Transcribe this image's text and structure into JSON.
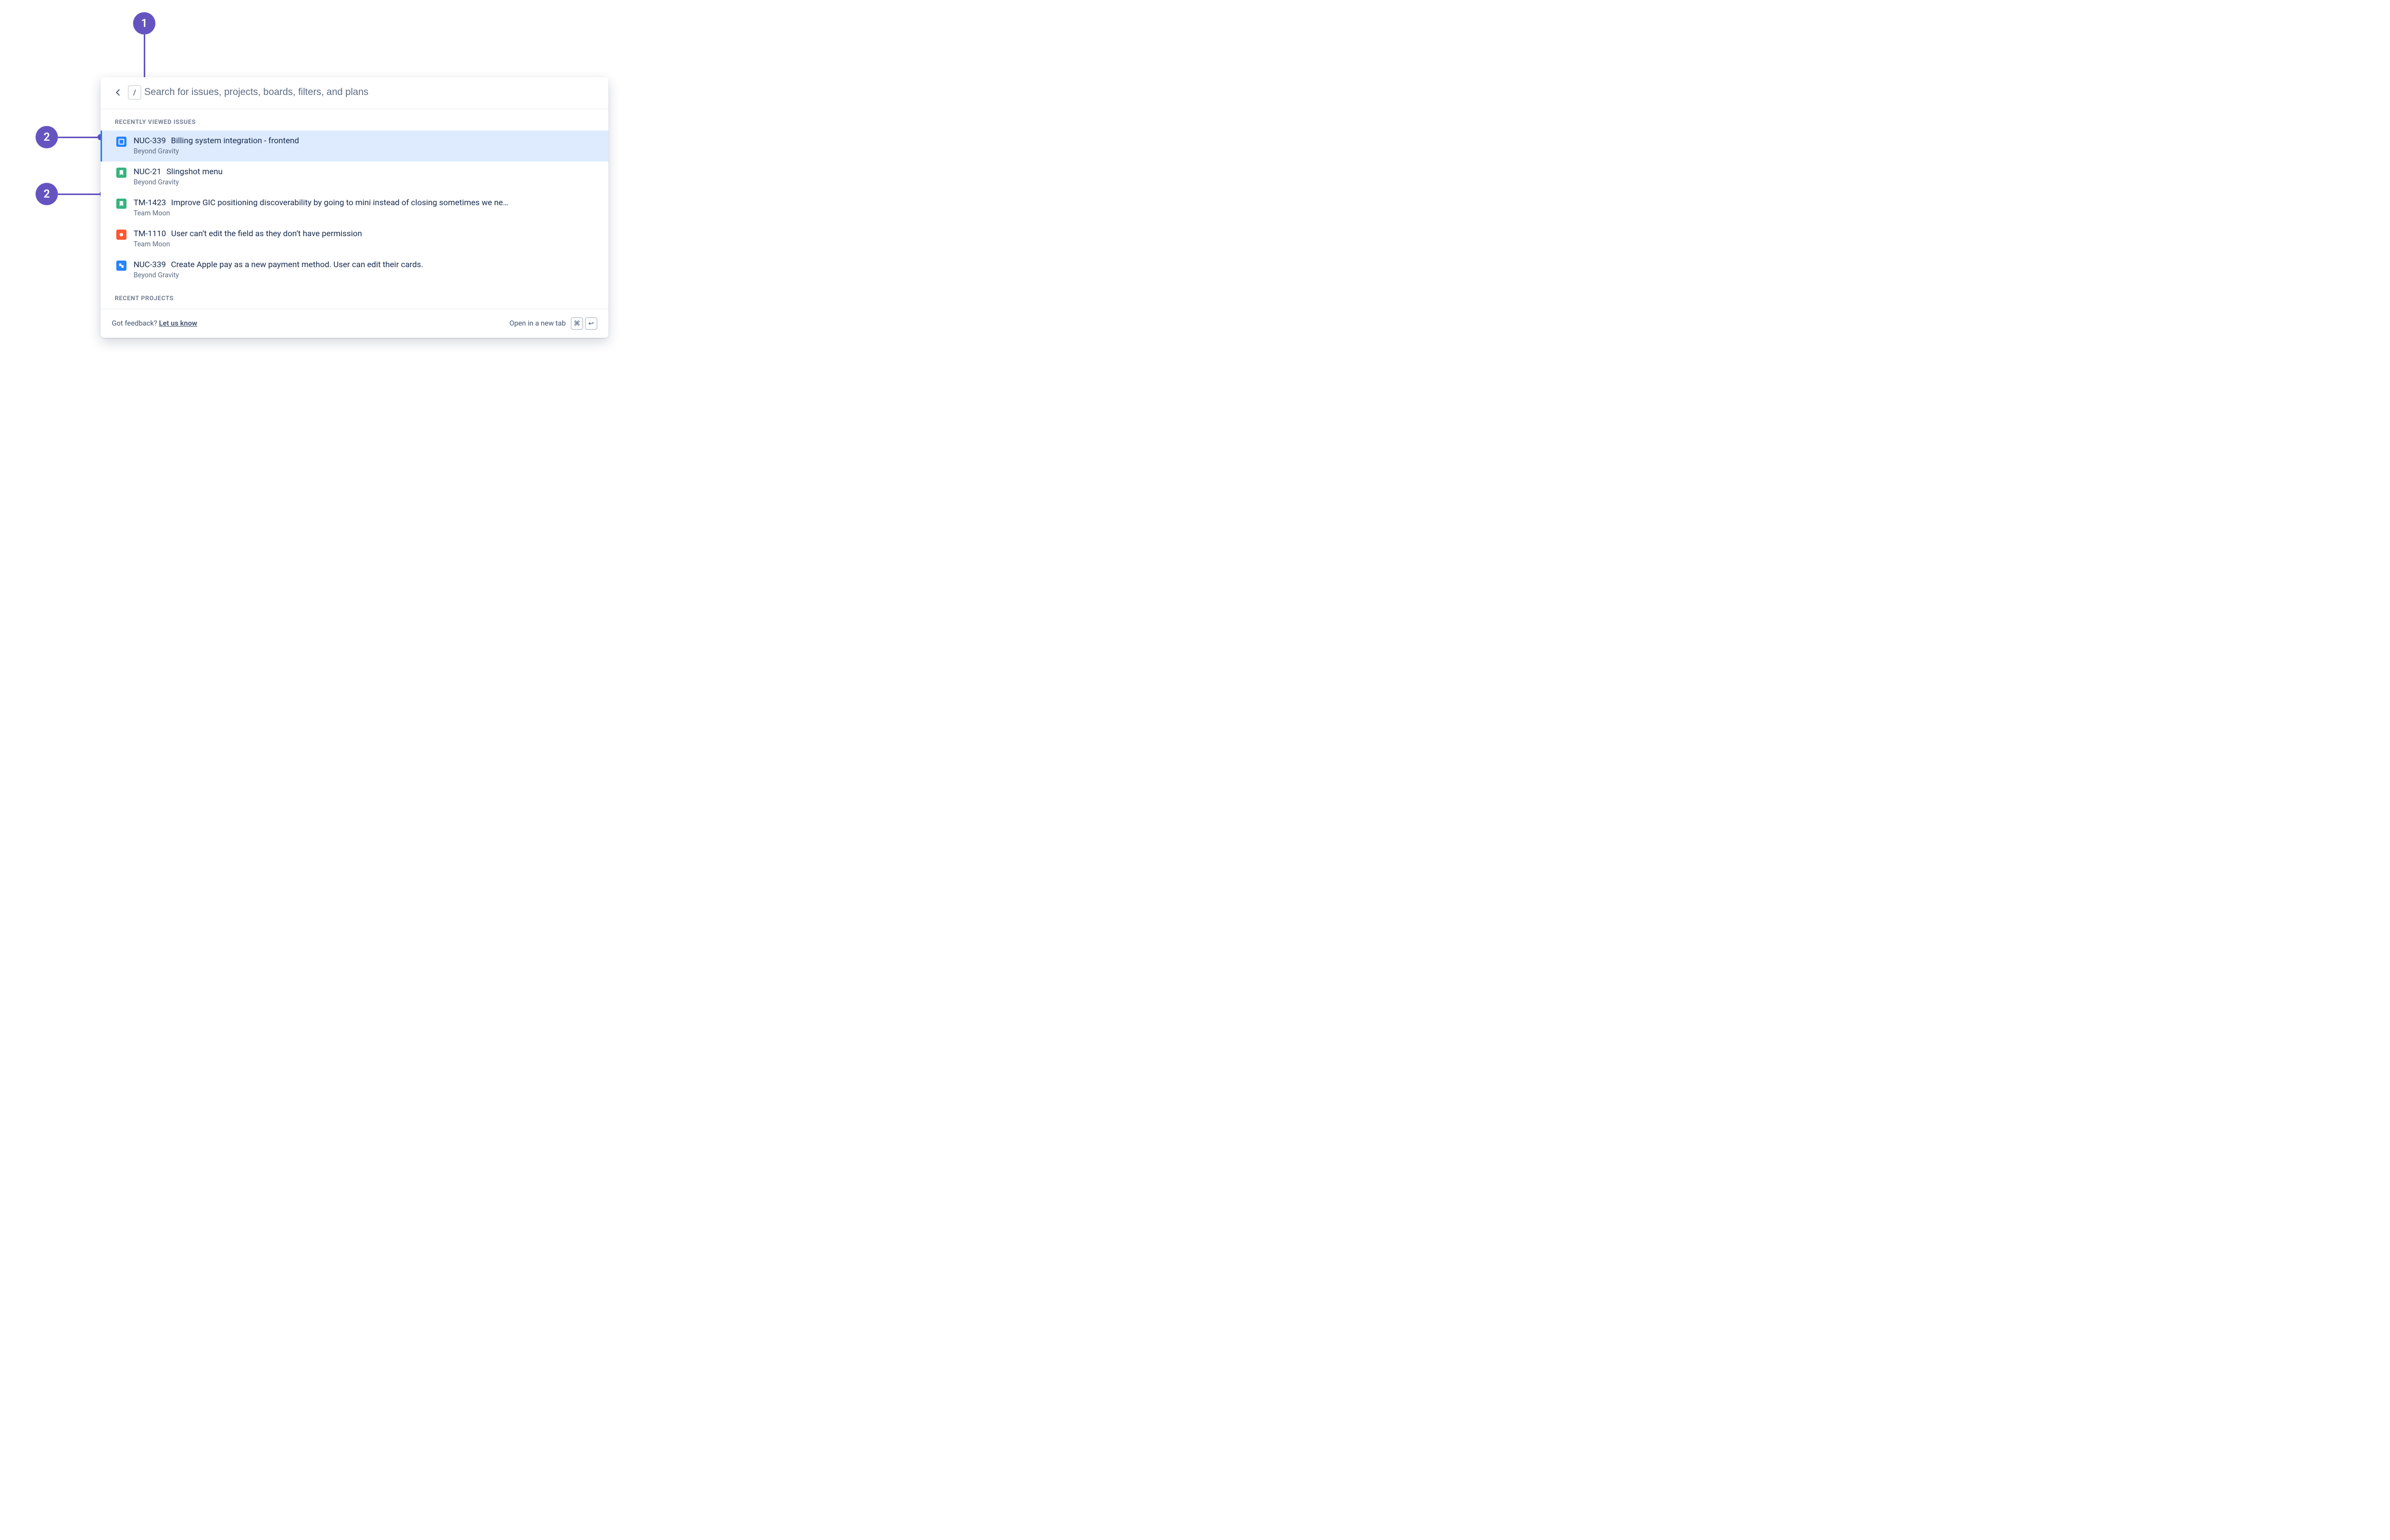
{
  "annotations": {
    "c1": "1",
    "c2": "2",
    "c3": "2"
  },
  "search": {
    "placeholder": "Search for issues, projects, boards, filters, and plans",
    "slash_key": "/"
  },
  "sections": {
    "recent_issues_header": "RECENTLY VIEWED ISSUES",
    "recent_projects_header": "RECENT PROJECTS"
  },
  "issues": [
    {
      "key": "NUC-339",
      "summary": "Billing system integration - frontend",
      "project": "Beyond Gravity",
      "type": "task",
      "highlight": true,
      "showProject": true
    },
    {
      "key": "NUC-21",
      "summary": "Slingshot menu",
      "project": "Beyond Gravity",
      "type": "story",
      "highlight": false,
      "showProject": true
    },
    {
      "key": "TM-1423",
      "summary": "Improve GIC positioning discoverability by going to mini instead of closing sometimes we ne…",
      "project": "Team Moon",
      "type": "story",
      "highlight": false,
      "showProject": true
    },
    {
      "key": "TM-1110",
      "summary": "User can’t edit the field as they don’t have permission",
      "project": "Team Moon",
      "type": "bug",
      "highlight": false,
      "showProject": true
    },
    {
      "key": "NUC-339",
      "summary": "Create Apple pay as a new payment method. User can edit their cards.",
      "project": "Beyond Gravity",
      "type": "epic",
      "highlight": false,
      "showProject": true
    }
  ],
  "footer": {
    "feedback_question": "Got feedback? ",
    "feedback_link": "Let us know",
    "open_new_tab": "Open in a new tab",
    "cmd_key": "⌘",
    "enter_key": "↩"
  }
}
